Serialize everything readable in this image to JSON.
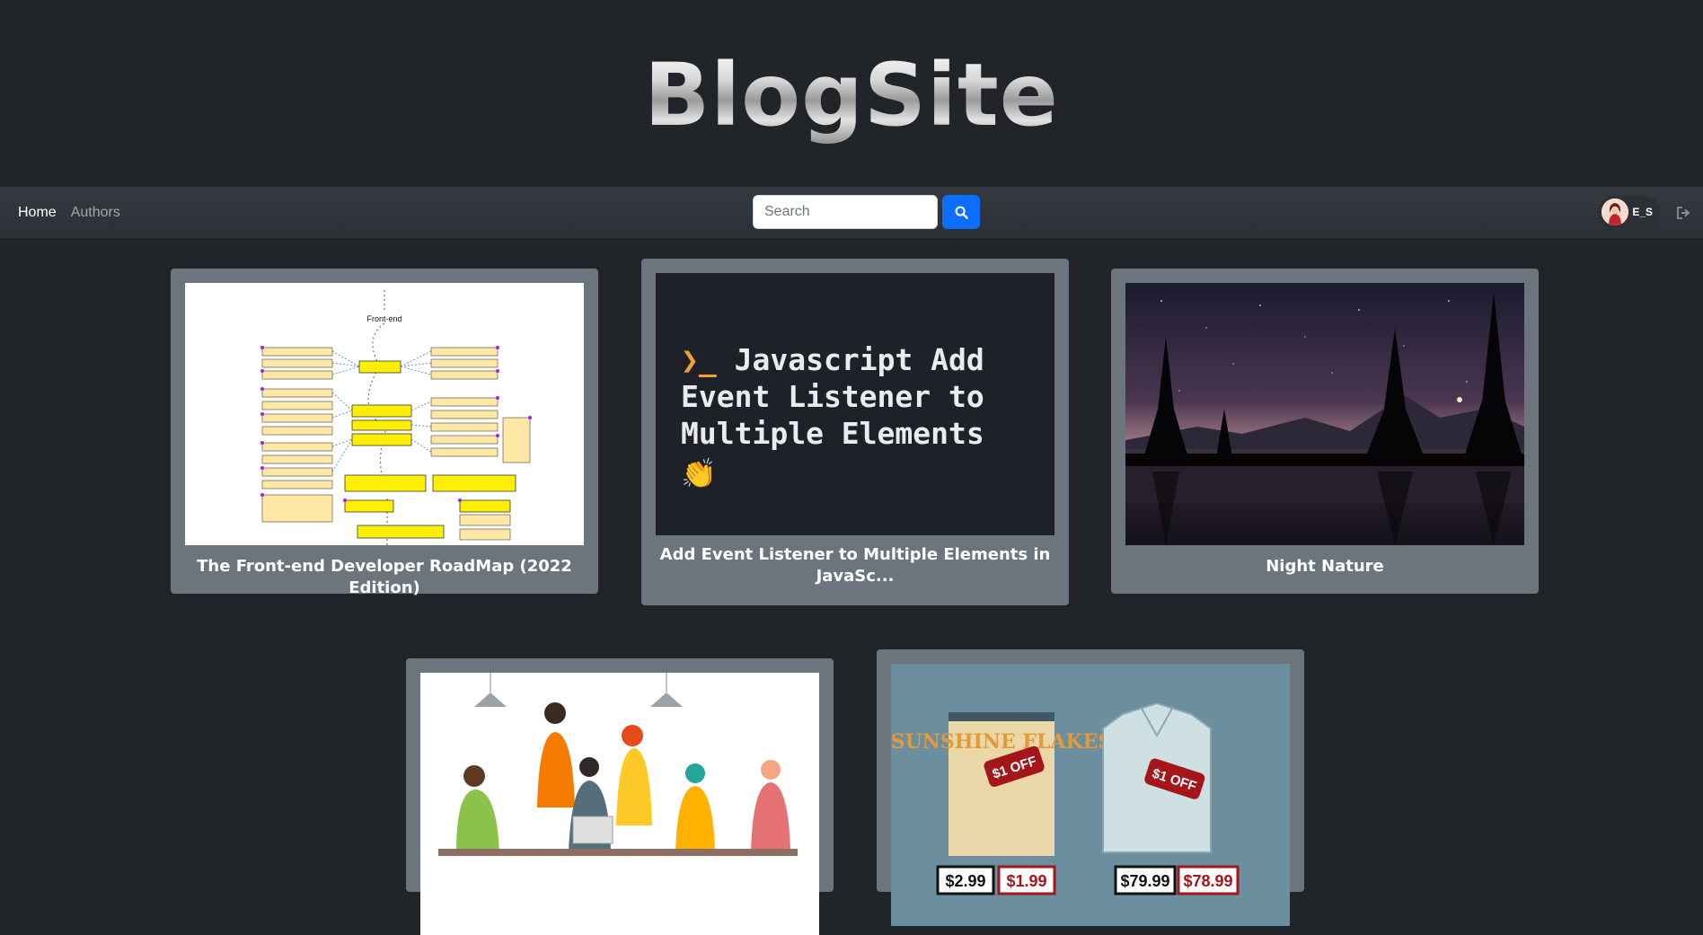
{
  "site": {
    "logo": "BlogSite"
  },
  "nav": {
    "links": [
      {
        "label": "Home",
        "active": true
      },
      {
        "label": "Authors",
        "active": false
      }
    ]
  },
  "search": {
    "placeholder": "Search",
    "value": "",
    "button_icon": "search-icon"
  },
  "user": {
    "name": "E_S",
    "avatar": "avatar-woman",
    "logout_icon": "logout-icon"
  },
  "posts": [
    {
      "title": "The Front-end Developer RoadMap (2022 Edition)",
      "thumbnail": "frontend-roadmap-diagram"
    },
    {
      "title": "Add Event Listener to Multiple Elements in JavaSc...",
      "thumbnail": "code-banner",
      "banner": {
        "prompt": "❯_",
        "text": "Javascript Add Event Listener to Multiple Elements",
        "emoji": "👏"
      }
    },
    {
      "title": "Night Nature",
      "thumbnail": "night-lake-photo"
    },
    {
      "title": "",
      "thumbnail": "team-illustration"
    },
    {
      "title": "",
      "thumbnail": "discount-tags-illustration",
      "labels": {
        "brand": "SUNSHINE FLAKES",
        "tag1": "$1 OFF",
        "tag2": "$1 OFF",
        "price1": "$2.99",
        "price2": "$1.99",
        "price3": "$79.99",
        "price4": "$78.99"
      }
    }
  ],
  "colors": {
    "page_bg": "#212529",
    "card_bg": "#6c757d",
    "accent": "#0d6efd"
  }
}
